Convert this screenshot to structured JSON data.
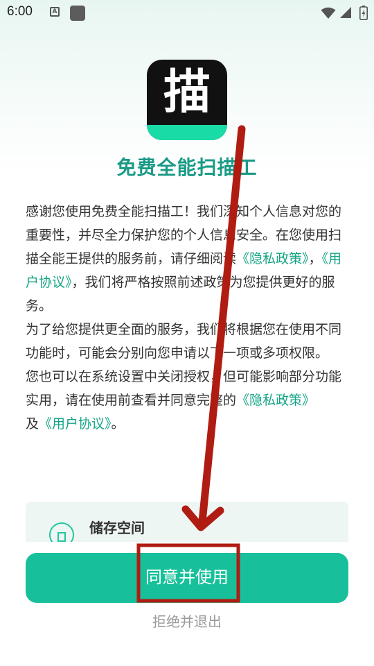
{
  "status_bar": {
    "time": "6:00",
    "notification_icon_letter": "A",
    "icons": [
      "a-notification-icon",
      "app-notification-icon",
      "wifi-icon",
      "signal-icon",
      "battery-icon"
    ]
  },
  "app": {
    "logo_char": "描",
    "name": "免费全能扫描工",
    "colors": {
      "brand": "#19dba6",
      "title": "#1a9a86",
      "link": "#15a486",
      "button": "#17c09a"
    }
  },
  "intro": {
    "p1_a": "感谢您使用免费全能扫描工！我们深知个人信息对您的重要性，并尽全力保护您的个人信息安全。在您使用扫描全能王提供的服务前，请仔细阅读",
    "p1_privacy": "《隐私政策》",
    "p1_sep": "，",
    "p1_terms": "《用户协议》",
    "p1_b": "，我们将严格按照前述政策为您提供更好的服务。",
    "p2": "为了给您提供更全面的服务，我们将根据您在使用不同功能时，可能会分别向您申请以下一项或多项权限。",
    "p3_a": "您也可以在系统设置中关闭授权，但可能影响部分功能实用，请在使用前查看并同意完整的",
    "p3_privacy": "《隐私政策》",
    "p3_mid": "及",
    "p3_terms": "《用户协议》",
    "p3_end": "。"
  },
  "permission": {
    "title": "储存空间",
    "icon": "storage-icon"
  },
  "actions": {
    "agree_label": "同意并使用",
    "decline_label": "拒绝并退出"
  },
  "annotation": {
    "arrow_color": "#b01c12",
    "box_color": "#b01c12"
  }
}
